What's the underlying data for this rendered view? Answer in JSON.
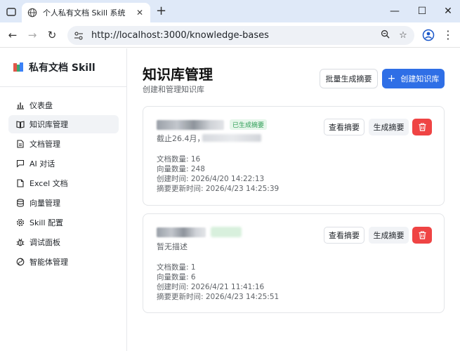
{
  "browser": {
    "tab_title": "个人私有文档 Skill 系统",
    "url": "http://localhost:3000/knowledge-bases"
  },
  "sidebar": {
    "brand": "私有文档 Skill",
    "items": [
      {
        "label": "仪表盘",
        "icon": "bar-chart-icon"
      },
      {
        "label": "知识库管理",
        "icon": "book-open-icon",
        "active": true
      },
      {
        "label": "文档管理",
        "icon": "file-text-icon"
      },
      {
        "label": "AI 对话",
        "icon": "message-icon"
      },
      {
        "label": "Excel 文档",
        "icon": "file-icon"
      },
      {
        "label": "向量管理",
        "icon": "database-icon"
      },
      {
        "label": "Skill 配置",
        "icon": "gear-icon"
      },
      {
        "label": "调试面板",
        "icon": "bug-icon"
      },
      {
        "label": "智能体管理",
        "icon": "agent-icon"
      }
    ]
  },
  "header": {
    "title": "知识库管理",
    "subtitle": "创建和管理知识库",
    "batch_button": "批量生成摘要",
    "create_button": "创建知识库"
  },
  "cards": [
    {
      "badge": "已生成摘要",
      "description_prefix": "截止26.4月，",
      "doc_count": "文档数量: 16",
      "vector_count": "向量数量: 248",
      "created": "创建时间: 2026/4/20 14:22:13",
      "summary_updated": "摘要更新时间: 2026/4/23 14:25:39",
      "view_button": "查看摘要",
      "generate_button": "生成摘要"
    },
    {
      "description": "暂无描述",
      "doc_count": "文档数量: 1",
      "vector_count": "向量数量: 6",
      "created": "创建时间: 2026/4/21 11:41:16",
      "summary_updated": "摘要更新时间: 2026/4/23 14:25:51",
      "view_button": "查看摘要",
      "generate_button": "生成摘要"
    }
  ],
  "colors": {
    "primary": "#2f6fe6",
    "danger": "#ef4444",
    "badge_text": "#2f9e57",
    "badge_bg": "#e6f6ea"
  }
}
